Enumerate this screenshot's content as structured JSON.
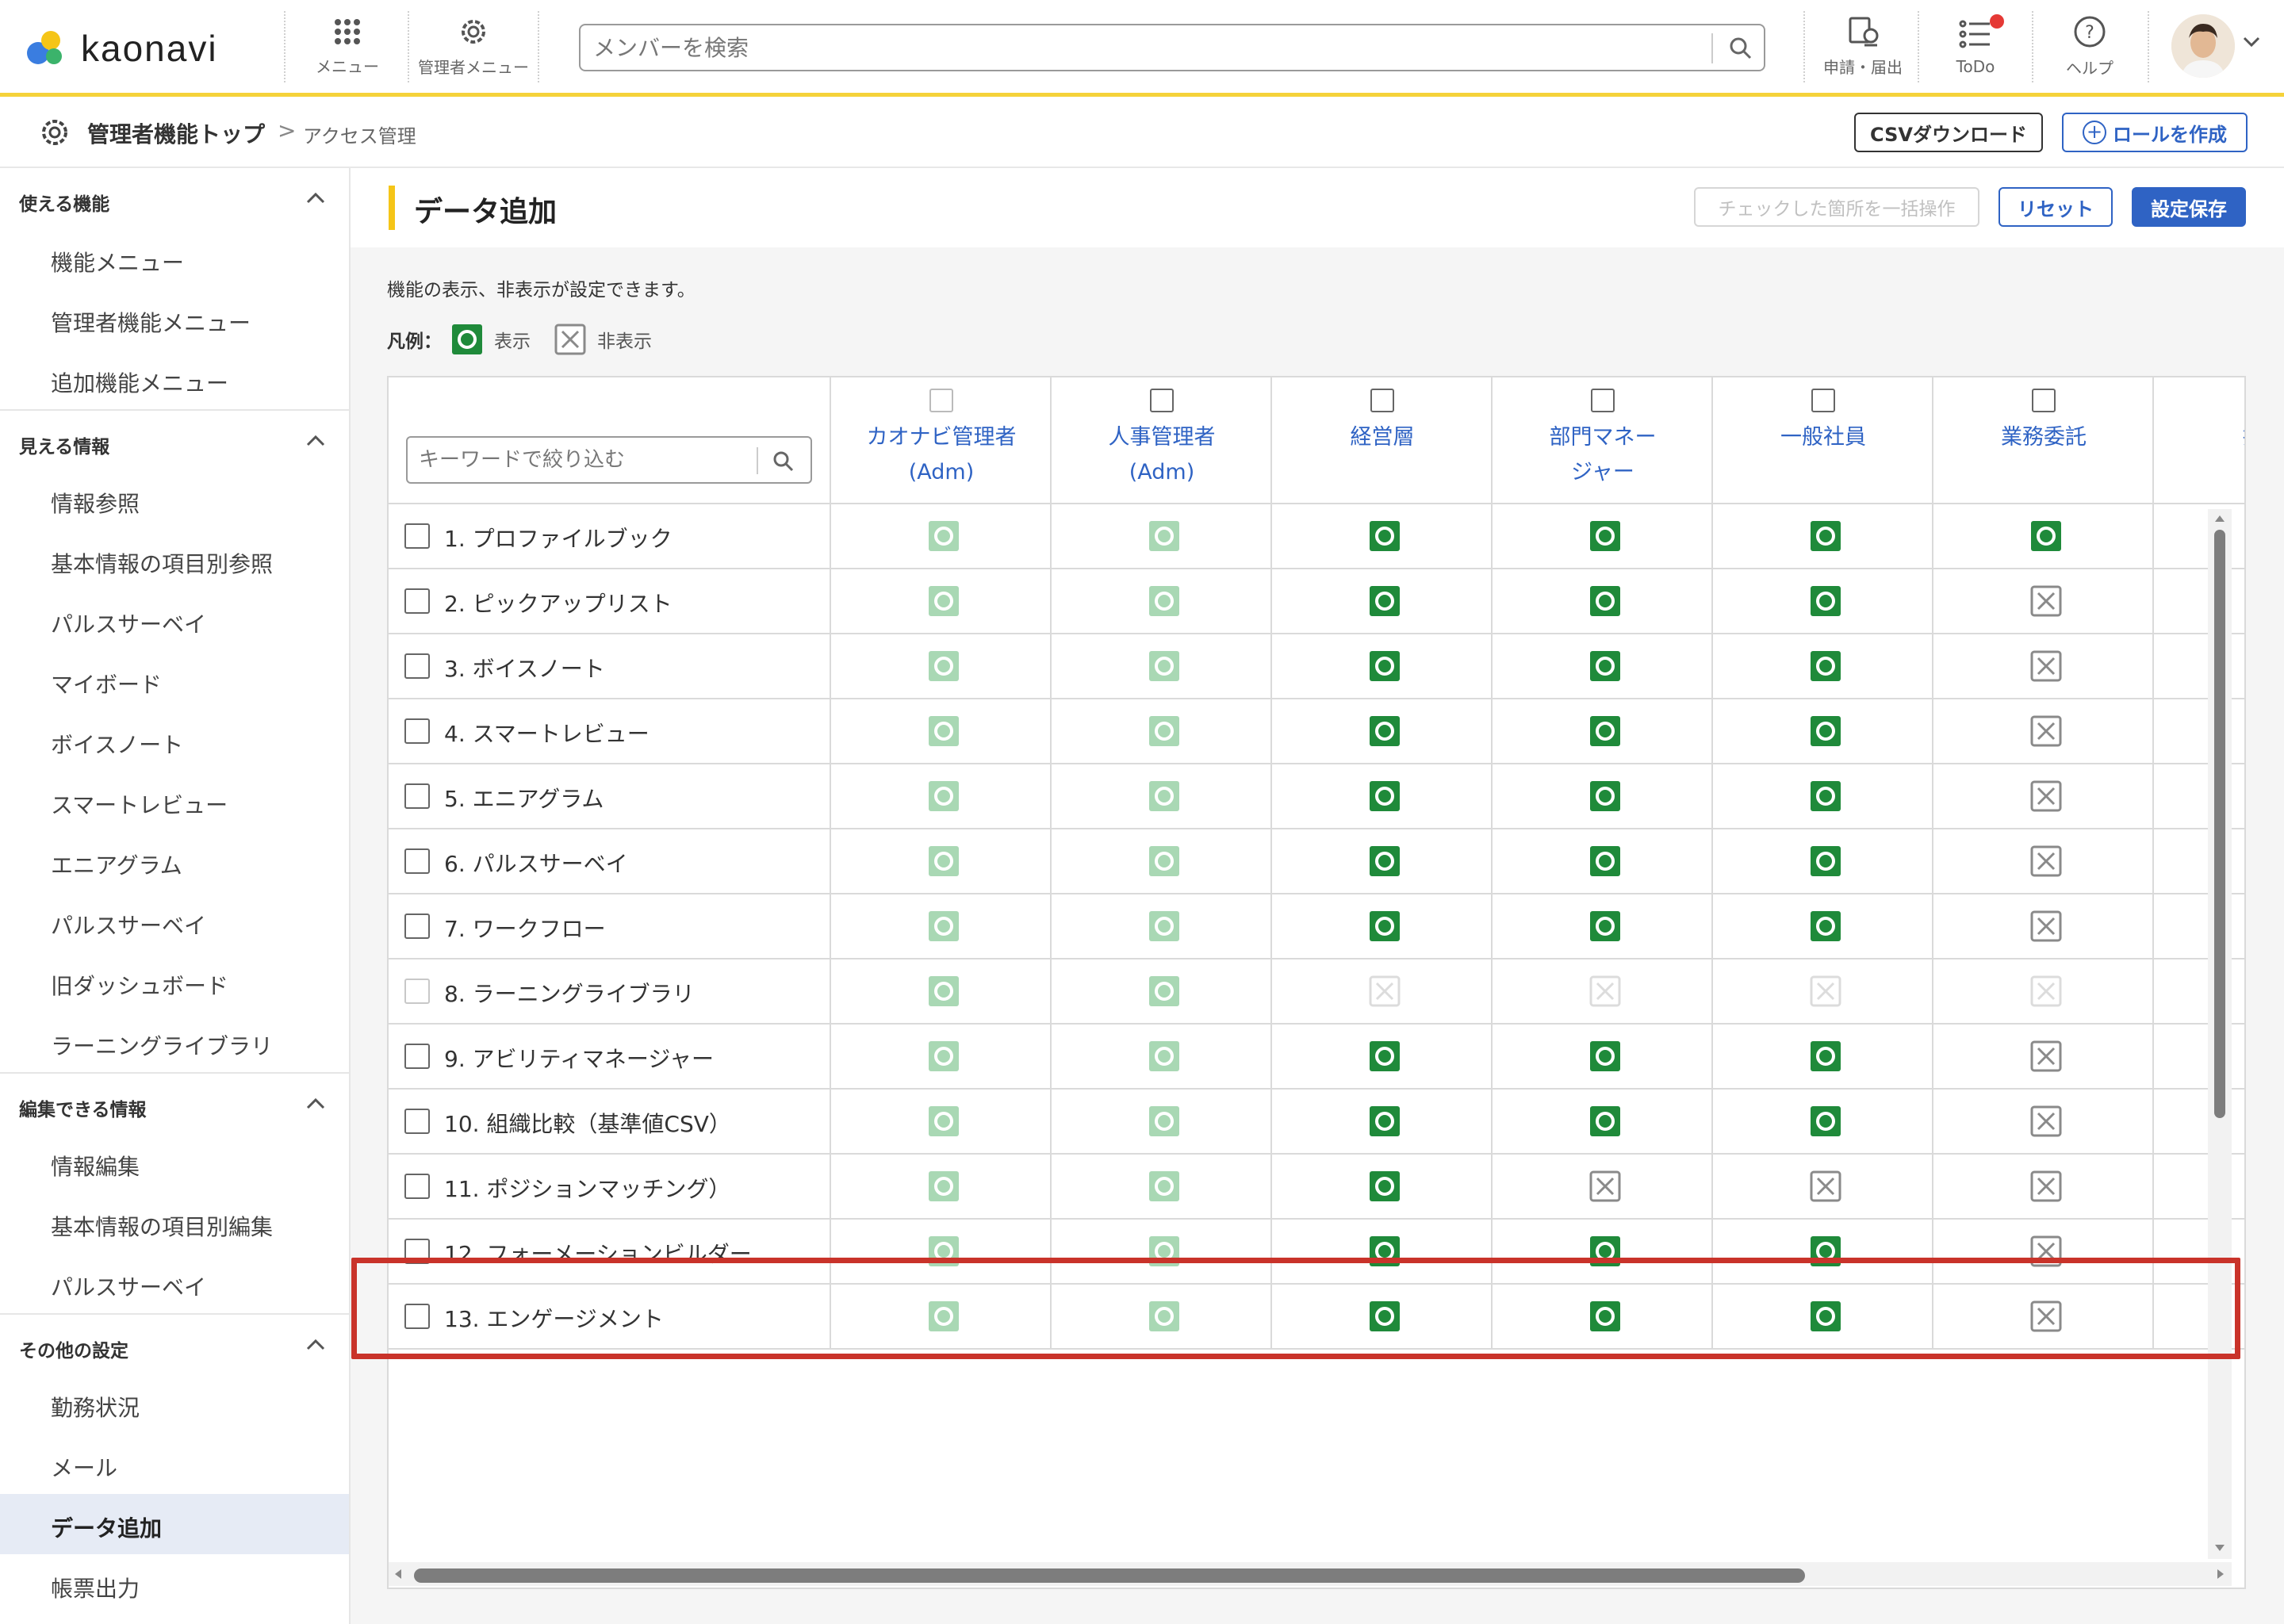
{
  "header": {
    "logo_text": "kaonavi",
    "menu_label": "メニュー",
    "admin_menu_label": "管理者メニュー",
    "search_placeholder": "メンバーを検索",
    "apply_label": "申請・届出",
    "todo_label": "ToDo",
    "help_label": "ヘルプ"
  },
  "breadcrumb": {
    "root": "管理者機能トップ",
    "separator": ">",
    "current": "アクセス管理"
  },
  "actions": {
    "csv_download": "CSVダウンロード",
    "create_role": "ロールを作成"
  },
  "sidebar": {
    "sections": [
      {
        "title": "使える機能",
        "items": [
          "機能メニュー",
          "管理者機能メニュー",
          "追加機能メニュー"
        ]
      },
      {
        "title": "見える情報",
        "items": [
          "情報参照",
          "基本情報の項目別参照",
          "パルスサーベイ",
          "マイボード",
          "ボイスノート",
          "スマートレビュー",
          "エニアグラム",
          "パルスサーベイ",
          "旧ダッシュボード",
          "ラーニングライブラリ"
        ]
      },
      {
        "title": "編集できる情報",
        "items": [
          "情報編集",
          "基本情報の項目別編集",
          "パルスサーベイ"
        ]
      },
      {
        "title": "その他の設定",
        "items": [
          "勤務状況",
          "メール",
          "データ追加",
          "帳票出力"
        ]
      }
    ],
    "active_item": "データ追加"
  },
  "panel": {
    "title": "データ追加",
    "bulk_button": "チェックした箇所を一括操作",
    "reset_button": "リセット",
    "save_button": "設定保存",
    "description": "機能の表示、非表示が設定できます。",
    "legend_label": "凡例：",
    "legend_show": "表示",
    "legend_hide": "非表示"
  },
  "table": {
    "filter_placeholder": "キーワードで絞り込む",
    "columns": [
      {
        "line1": "カオナビ管理者",
        "line2": "(Adm)",
        "checkbox_disabled": true
      },
      {
        "line1": "人事管理者",
        "line2": "(Adm)",
        "checkbox_disabled": false
      },
      {
        "line1": "経営層",
        "line2": "",
        "checkbox_disabled": false
      },
      {
        "line1": "部門マネー",
        "line2": "ジャー",
        "checkbox_disabled": false
      },
      {
        "line1": "一般社員",
        "line2": "",
        "checkbox_disabled": false
      },
      {
        "line1": "業務委託",
        "line2": "",
        "checkbox_disabled": false
      },
      {
        "line1": "採用",
        "line2": "",
        "checkbox_disabled": false
      }
    ],
    "rows": [
      {
        "name": "1. プロファイルブック",
        "disabled": false,
        "cells": [
          "show-locked",
          "show-locked",
          "show",
          "show",
          "show",
          "show"
        ]
      },
      {
        "name": "2. ピックアップリスト",
        "disabled": false,
        "cells": [
          "show-locked",
          "show-locked",
          "show",
          "show",
          "show",
          "hide"
        ]
      },
      {
        "name": "3. ボイスノート",
        "disabled": false,
        "cells": [
          "show-locked",
          "show-locked",
          "show",
          "show",
          "show",
          "hide"
        ]
      },
      {
        "name": "4. スマートレビュー",
        "disabled": false,
        "cells": [
          "show-locked",
          "show-locked",
          "show",
          "show",
          "show",
          "hide"
        ]
      },
      {
        "name": "5. エニアグラム",
        "disabled": false,
        "cells": [
          "show-locked",
          "show-locked",
          "show",
          "show",
          "show",
          "hide"
        ]
      },
      {
        "name": "6. パルスサーベイ",
        "disabled": false,
        "cells": [
          "show-locked",
          "show-locked",
          "show",
          "show",
          "show",
          "hide"
        ]
      },
      {
        "name": "7. ワークフロー",
        "disabled": false,
        "cells": [
          "show-locked",
          "show-locked",
          "show",
          "show",
          "show",
          "hide"
        ]
      },
      {
        "name": "8. ラーニングライブラリ",
        "disabled": true,
        "cells": [
          "show-locked",
          "show-locked",
          "hide-locked",
          "hide-locked",
          "hide-locked",
          "hide-locked"
        ]
      },
      {
        "name": "9. アビリティマネージャー",
        "disabled": false,
        "cells": [
          "show-locked",
          "show-locked",
          "show",
          "show",
          "show",
          "hide"
        ]
      },
      {
        "name": "10. 組織比較（基準値CSV）",
        "disabled": false,
        "cells": [
          "show-locked",
          "show-locked",
          "show",
          "show",
          "show",
          "hide"
        ]
      },
      {
        "name": "11. ポジションマッチング）",
        "disabled": false,
        "cells": [
          "show-locked",
          "show-locked",
          "show",
          "hide",
          "hide",
          "hide"
        ]
      },
      {
        "name": "12. フォーメーションビルダー",
        "disabled": false,
        "cells": [
          "show-locked",
          "show-locked",
          "show",
          "show",
          "show",
          "hide"
        ]
      },
      {
        "name": "13. エンゲージメント",
        "disabled": false,
        "cells": [
          "show-locked",
          "show-locked",
          "show",
          "show",
          "show",
          "hide"
        ]
      }
    ]
  },
  "colors": {
    "accent": "#2f63c4",
    "header_underline": "#f5d23a",
    "show_green": "#1f8a3a",
    "show_locked_green": "#a9d8b4",
    "highlight_red": "#c9332a"
  }
}
